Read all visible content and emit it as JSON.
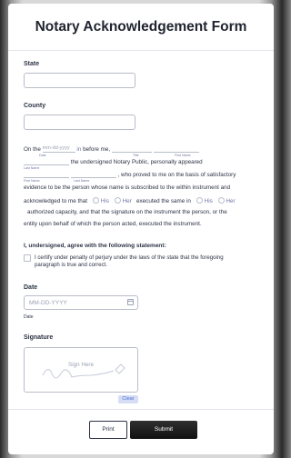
{
  "title": "Notary Acknowledgement Form",
  "state": {
    "label": "State"
  },
  "county": {
    "label": "County"
  },
  "ack": {
    "on_the": "On the",
    "date_placeholder": "mm-dd-yyyy",
    "in": "in",
    "before_me": "before me,",
    "date_sub": "Date",
    "title_sub": "Title",
    "first_name_sub": "First Name",
    "undersigned": "the undersigned Notary Public, personally appeared",
    "last_name_sub": "Last Name",
    "proved": ", who proved to me on the basis of satisfactory",
    "first_name_sub2": "First Name",
    "last_name_sub2": "Last Name",
    "evidence": "evidence to be the person whose name is subscribed to the within instrument and",
    "acknowledged": "acknowledged to me that",
    "his": "His",
    "her": "Her",
    "executed": "executed the same in",
    "his2": "His",
    "her2": "Her",
    "authorized": "authorized capacity, and that the signature on the instrument the person, or the",
    "entity": "entity upon behalf of which the person acted, executed the instrument."
  },
  "agree": {
    "label": "I, undersigned, agree with the following statement:",
    "text1": "I certify under penalty of perjury under the laws of the state that the foregoing",
    "text2": "paragraph is true and correct."
  },
  "date": {
    "label": "Date",
    "placeholder": "MM-DD-YYYY",
    "sublabel": "Date"
  },
  "signature": {
    "label": "Signature",
    "sign_here": "Sign Here",
    "clear": "Clear"
  },
  "buttons": {
    "print": "Print",
    "submit": "Submit"
  }
}
